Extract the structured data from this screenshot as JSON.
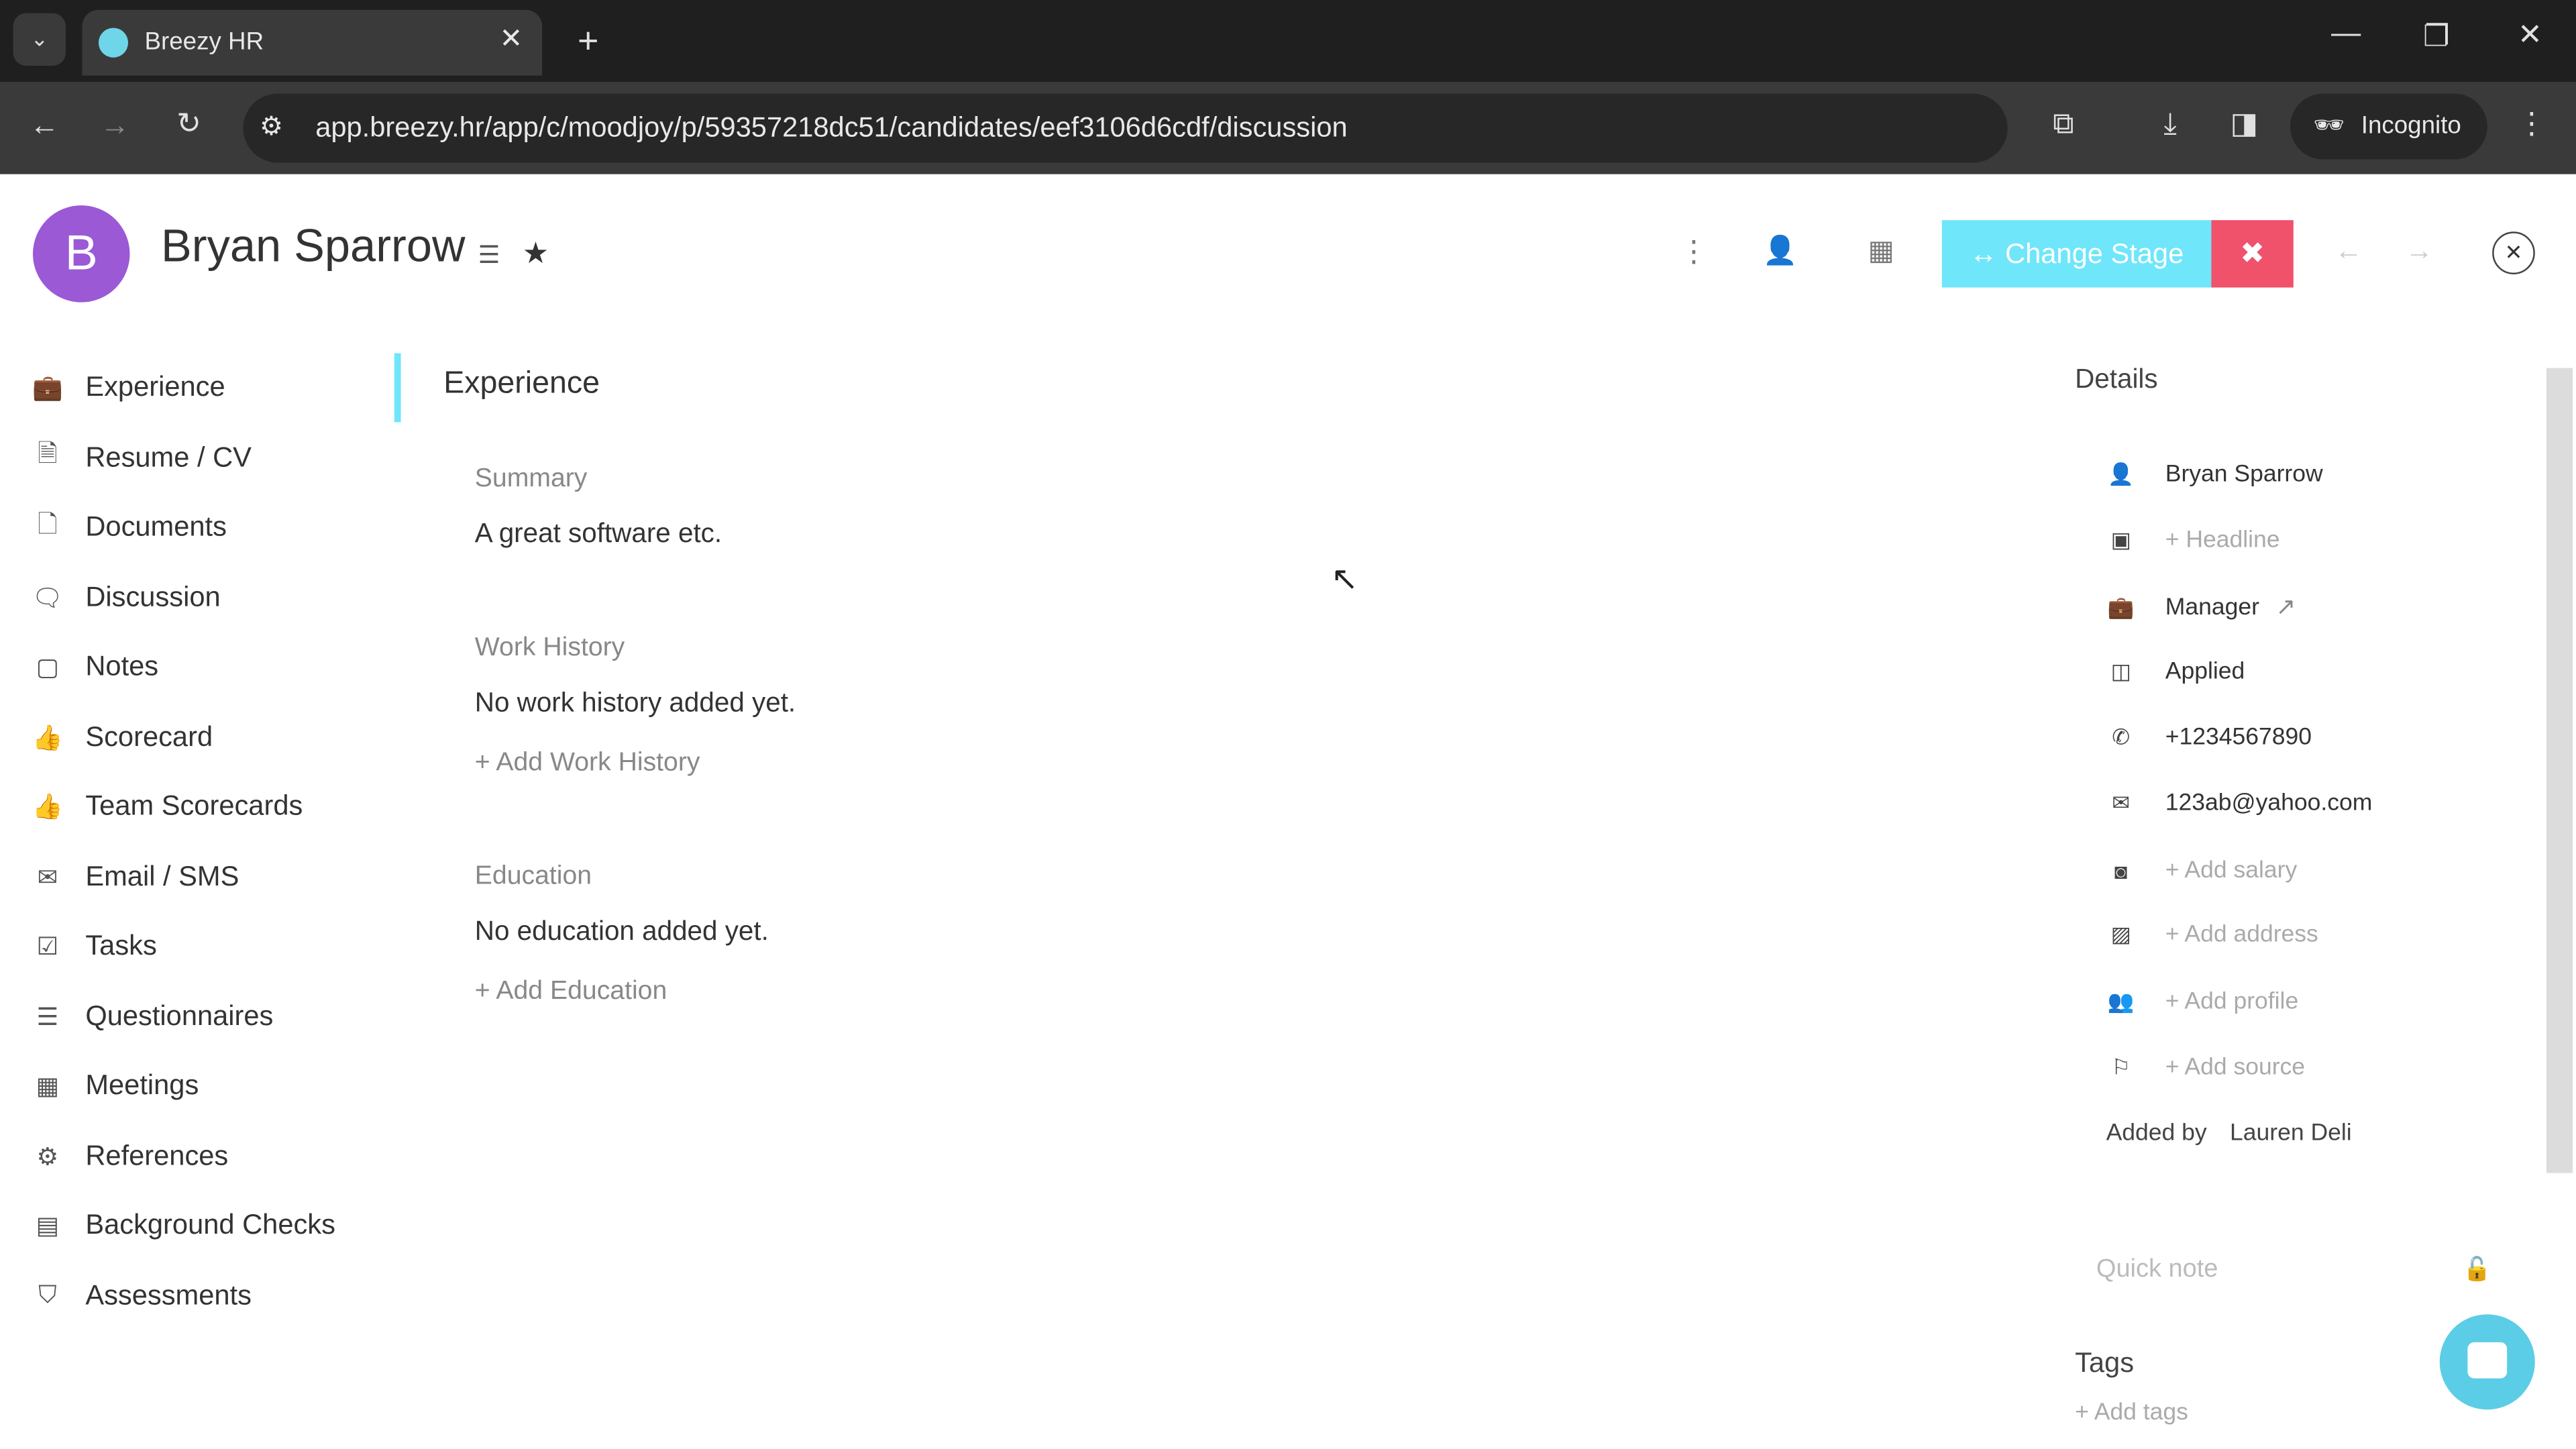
{
  "browser": {
    "tab_title": "Breezy HR",
    "url": "app.breezy.hr/app/c/moodjoy/p/59357218dc51/candidates/eef3106d6cdf/discussion",
    "incognito_label": "Incognito"
  },
  "candidate": {
    "initial": "B",
    "name": "Bryan Sparrow",
    "avatar_color": "#9b59d6"
  },
  "header": {
    "change_stage_label": "Change Stage",
    "change_stage_color": "#6fe6fa",
    "disqualify_color": "#f0516b"
  },
  "sidebar": {
    "items": [
      {
        "label": "Experience",
        "icon": "briefcase-icon",
        "glyph": "💼"
      },
      {
        "label": "Resume / CV",
        "icon": "resume-icon",
        "glyph": "🗎"
      },
      {
        "label": "Documents",
        "icon": "document-icon",
        "glyph": "🗋"
      },
      {
        "label": "Discussion",
        "icon": "discussion-icon",
        "glyph": "🗨"
      },
      {
        "label": "Notes",
        "icon": "notes-icon",
        "glyph": "▢"
      },
      {
        "label": "Scorecard",
        "icon": "thumbs-up-icon",
        "glyph": "👍"
      },
      {
        "label": "Team Scorecards",
        "icon": "thumbs-up-icon",
        "glyph": "👍"
      },
      {
        "label": "Email / SMS",
        "icon": "envelope-icon",
        "glyph": "✉"
      },
      {
        "label": "Tasks",
        "icon": "checkbox-icon",
        "glyph": "☑"
      },
      {
        "label": "Questionnaires",
        "icon": "list-icon",
        "glyph": "☰"
      },
      {
        "label": "Meetings",
        "icon": "calendar-icon",
        "glyph": "▦"
      },
      {
        "label": "References",
        "icon": "gear-icon",
        "glyph": "⚙"
      },
      {
        "label": "Background Checks",
        "icon": "id-card-icon",
        "glyph": "▤"
      },
      {
        "label": "Assessments",
        "icon": "shield-icon",
        "glyph": "⛉"
      }
    ]
  },
  "main": {
    "title": "Experience",
    "summary_heading": "Summary",
    "summary_text": "A great software etc.",
    "work_heading": "Work History",
    "work_empty": "No work history added yet.",
    "add_work": "+ Add Work History",
    "edu_heading": "Education",
    "edu_empty": "No education added yet.",
    "add_edu": "+ Add Education"
  },
  "details": {
    "title": "Details",
    "rows": [
      {
        "text": "Bryan Sparrow",
        "icon": "person-icon",
        "glyph": "👤",
        "muted": false
      },
      {
        "text": "+ Headline",
        "icon": "headline-icon",
        "glyph": "▣",
        "muted": true
      },
      {
        "text": "Manager",
        "icon": "briefcase-icon",
        "glyph": "💼",
        "muted": false
      },
      {
        "text": "Applied",
        "icon": "stage-icon",
        "glyph": "◫",
        "muted": false
      },
      {
        "text": "+1234567890",
        "icon": "phone-icon",
        "glyph": "✆",
        "muted": false
      },
      {
        "text": "123ab@yahoo.com",
        "icon": "envelope-icon",
        "glyph": "✉",
        "muted": false
      },
      {
        "text": "+ Add salary",
        "icon": "money-icon",
        "glyph": "◙",
        "muted": true
      },
      {
        "text": "+ Add address",
        "icon": "address-icon",
        "glyph": "▨",
        "muted": true
      },
      {
        "text": "+ Add profile",
        "icon": "people-icon",
        "glyph": "👥",
        "muted": true
      },
      {
        "text": "+ Add source",
        "icon": "flag-icon",
        "glyph": "⚐",
        "muted": true
      }
    ],
    "added_by_label": "Added by",
    "added_by": "Lauren Deli",
    "quick_note_placeholder": "Quick note",
    "tags_title": "Tags",
    "add_tags": "+ Add tags"
  }
}
